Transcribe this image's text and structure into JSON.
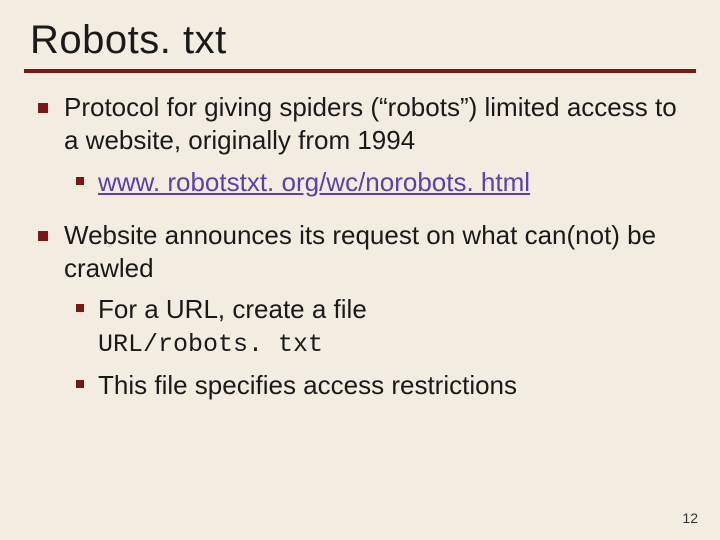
{
  "title": "Robots. txt",
  "bullets": {
    "b1": "Protocol for giving spiders (“robots”) limited access to a website, originally from 1994",
    "b1_sub1_link": "www. robotstxt. org/wc/norobots. html",
    "b2": "Website announces its request on what can(not) be crawled",
    "b2_sub1": "For a URL, create a file",
    "b2_sub1_code": "URL/robots. txt",
    "b2_sub2": "This file specifies access restrictions"
  },
  "page_number": "12"
}
